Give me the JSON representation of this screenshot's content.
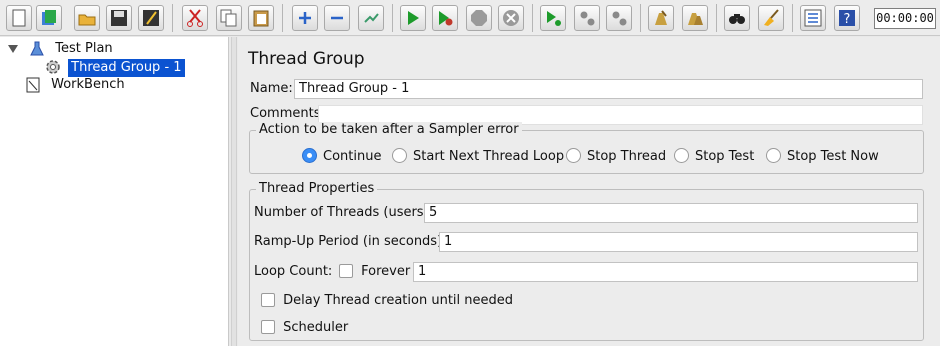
{
  "toolbar": {
    "buttons": [
      {
        "name": "new-icon"
      },
      {
        "name": "templates-icon"
      },
      {
        "name": "open-icon"
      },
      {
        "name": "save-icon"
      },
      {
        "name": "save-as-icon"
      },
      {
        "name": "cut-icon"
      },
      {
        "name": "copy-icon"
      },
      {
        "name": "paste-icon"
      },
      {
        "name": "expand-all-icon"
      },
      {
        "name": "collapse-all-icon"
      },
      {
        "name": "toggle-icon"
      },
      {
        "name": "start-icon"
      },
      {
        "name": "start-no-pauses-icon"
      },
      {
        "name": "stop-icon"
      },
      {
        "name": "shutdown-icon"
      },
      {
        "name": "remote-start-all-icon"
      },
      {
        "name": "remote-stop-all-icon"
      },
      {
        "name": "remote-shutdown-all-icon"
      },
      {
        "name": "clear-icon"
      },
      {
        "name": "clear-all-icon"
      },
      {
        "name": "search-icon"
      },
      {
        "name": "reset-search-icon"
      },
      {
        "name": "function-helper-icon"
      },
      {
        "name": "help-icon"
      }
    ],
    "timer": "00:00:00"
  },
  "tree": {
    "root": "Test Plan",
    "child": "Thread Group - 1",
    "workbench": "WorkBench"
  },
  "main": {
    "title": "Thread Group",
    "name_label": "Name:",
    "name_value": "Thread Group - 1",
    "comments_label": "Comments:",
    "comments_value": "",
    "error_action": {
      "legend": "Action to be taken after a Sampler error",
      "options": [
        "Continue",
        "Start Next Thread Loop",
        "Stop Thread",
        "Stop Test",
        "Stop Test Now"
      ],
      "selected": "Continue"
    },
    "thread_props": {
      "legend": "Thread Properties",
      "threads_label": "Number of Threads (users):",
      "threads_value": "5",
      "rampup_label": "Ramp-Up Period (in seconds):",
      "rampup_value": "1",
      "loop_label": "Loop Count:",
      "forever_label": "Forever",
      "loop_value": "1",
      "delay_label": "Delay Thread creation until needed",
      "scheduler_label": "Scheduler"
    }
  },
  "colors": {
    "selection": "#0b53d1",
    "radio_selected": "#3a8ef6",
    "run_green": "#1d9b2b"
  }
}
